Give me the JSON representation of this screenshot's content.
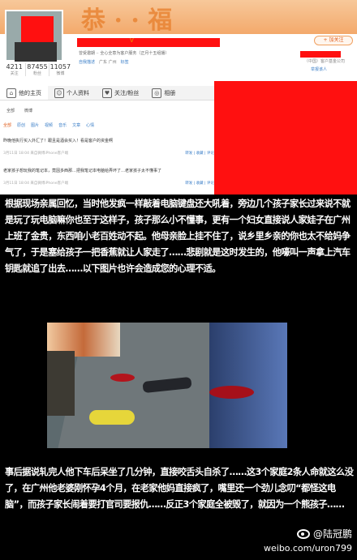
{
  "profile": {
    "stats": [
      {
        "num": "4211",
        "label": "关注"
      },
      {
        "num": "87455",
        "label": "粉丝"
      },
      {
        "num": "11057",
        "label": "微博"
      }
    ],
    "name_suffix": "V",
    "intro": "曾受邀期 ·· 全心全意为客户服务（正月十五组播）",
    "info": [
      "自我描述",
      "广东 广州",
      "标签"
    ],
    "follow_button": "+ 加关注",
    "side_line1": "（中国）客户基金公司",
    "side_line2": "举报该人"
  },
  "tabs": [
    {
      "icon": "home-icon",
      "label": "他的主页"
    },
    {
      "icon": "person-icon",
      "label": "个人资料"
    },
    {
      "icon": "heart-icon",
      "label": "关注/粉丝"
    },
    {
      "icon": "camera-icon",
      "label": "相册"
    }
  ],
  "subtabs": [
    "全部",
    "微博"
  ],
  "filters": [
    "全部",
    "原创",
    "图片",
    "视频",
    "音乐",
    "文章",
    "心情"
  ],
  "posts": [
    {
      "text": "昨晚他执行买入外汇了！跟且是酒会买入！看是客户的资金啊",
      "date": "3月11日 18:04  来自微博iPhone客户端",
      "actions": "转发 | 收藏 | 评论"
    },
    {
      "text": "老家孩子想玩我的笔记本，竟因多西那…把我笔记本电脑给弄坏了…老家孩子太不懂事了",
      "date": "3月11日 18:04  来自微博iPhone客户端",
      "actions": "转发 | 收藏 | 评论"
    }
  ],
  "paragraph1": "根据现场亲属回忆，当时他发疯一样敲着电脑键盘还大吼着，旁边几个孩子家长过来说不就是玩了玩电脑嘛你也至于这样子，孩子那么小不懂事，更有一个妇女直接说人家娃子在广州上班了金贵，东西咱小老百姓动不起。他母亲脸上挂不住了，说乡里乡亲的你也太不给妈争气了，于是塞给孩子一把香蕉就让人家走了……悲剧就是这时发生的，他嚎叫一声拿上汽车钥匙就追了出去……以下图片也许会造成您的心理不适。",
  "paragraph2": "事后据说轧完人他下车后呆坐了几分钟，直接咬舌头自杀了……这3个家庭2条人命就这么没了，在广州他老婆刚怀孕4个月，在老家他妈直接疯了，嘴里还一个劲儿念叨“都怪这电脑”，而孩子家长闹着要打官司要报仇……反正3个家庭全被毁了，就因为一个熊孩子……",
  "watermark": {
    "handle": "@陆冠鹏",
    "url": "weibo.com/uron799"
  }
}
